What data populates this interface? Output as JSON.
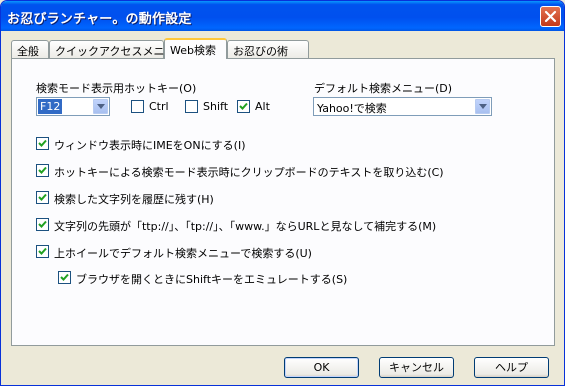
{
  "window": {
    "title": "お忍びランチャー。の動作設定"
  },
  "tabs": [
    {
      "label": "全般"
    },
    {
      "label": "クイックアクセスメニュー"
    },
    {
      "label": "Web検索"
    },
    {
      "label": "お忍びの術"
    }
  ],
  "hotkey": {
    "label": "検索モード表示用ホットキー(O)",
    "key_value": "F12",
    "modifiers": [
      {
        "label": "Ctrl",
        "checked": false
      },
      {
        "label": "Shift",
        "checked": false
      },
      {
        "label": "Alt",
        "checked": true
      }
    ]
  },
  "default_menu": {
    "label": "デフォルト検索メニュー(D)",
    "value": "Yahoo!で検索"
  },
  "options": [
    {
      "label": "ウィンドウ表示時にIMEをONにする(I)",
      "checked": true
    },
    {
      "label": "ホットキーによる検索モード表示時にクリップボードのテキストを取り込む(C)",
      "checked": true
    },
    {
      "label": "検索した文字列を履歴に残す(H)",
      "checked": true
    },
    {
      "label": "文字列の先頭が「ttp://」、「tp://」、「www.」ならURLと見なして補完する(M)",
      "checked": true
    },
    {
      "label": "上ホイールでデフォルト検索メニューで検索する(U)",
      "checked": true
    },
    {
      "label": "ブラウザを開くときにShiftキーをエミュレートする(S)",
      "checked": true
    }
  ],
  "buttons": {
    "ok": "OK",
    "cancel": "キャンセル",
    "help": "ヘルプ"
  },
  "colors": {
    "titlebar": "#0054e3",
    "dialog_bg": "#ece9d8",
    "panel_bg": "#fcfcfe",
    "check": "#21a121"
  }
}
